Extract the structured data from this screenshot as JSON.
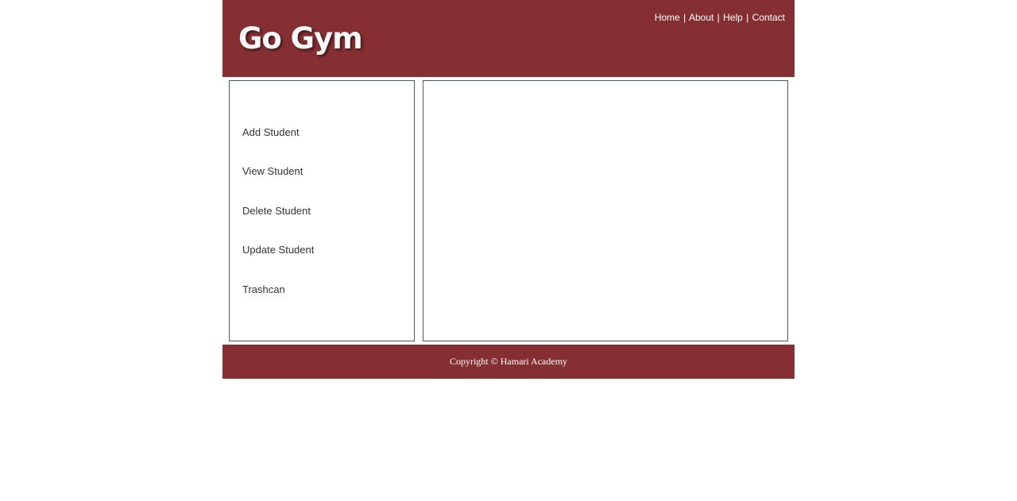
{
  "header": {
    "logo_text": "Go Gym",
    "nav": {
      "home": "Home",
      "about": "About",
      "help": "Help",
      "contact": "Contact",
      "separator": "|"
    }
  },
  "sidebar": {
    "items": [
      {
        "label": "Add Student"
      },
      {
        "label": "View Student"
      },
      {
        "label": "Delete Student"
      },
      {
        "label": "Update Student"
      },
      {
        "label": "Trashcan"
      }
    ]
  },
  "footer": {
    "copyright": "Copyright © Hamari Academy"
  },
  "colors": {
    "brand": "#852f32",
    "border": "#555555",
    "text": "#333333"
  }
}
